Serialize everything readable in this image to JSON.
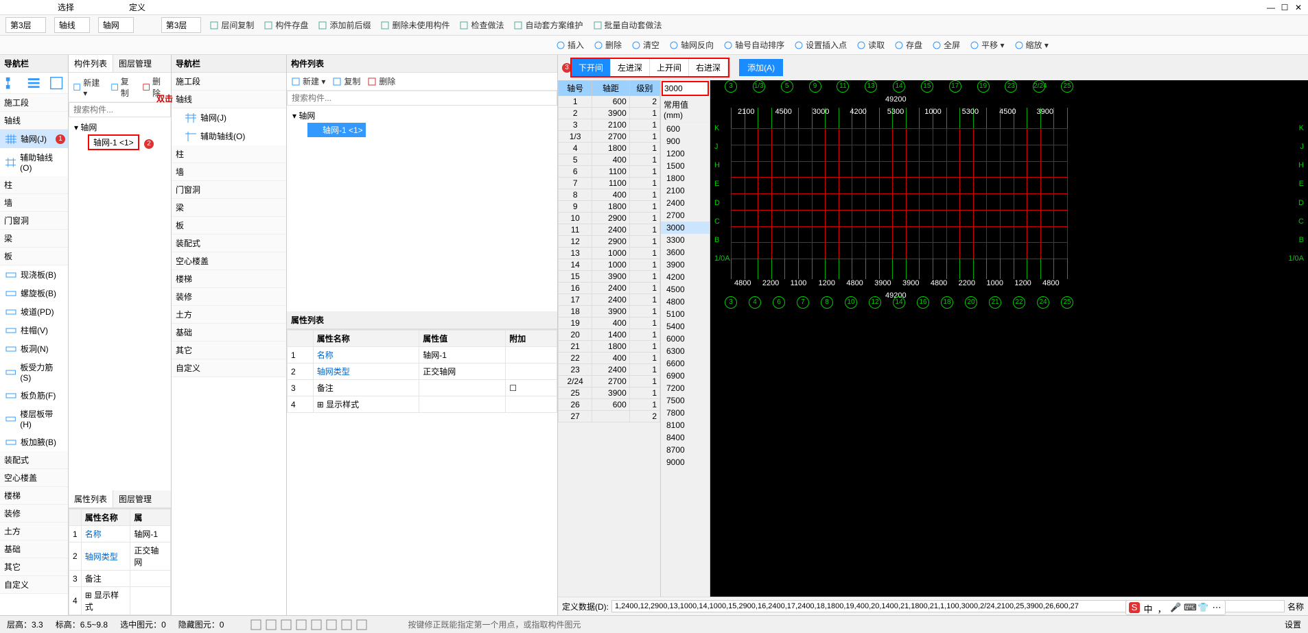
{
  "title_left": "选择",
  "title_center": "定义",
  "window_controls": {
    "min": "—",
    "max": "☐",
    "close": "✕"
  },
  "top_selects": {
    "floor_a": "第3层",
    "axis_a": "轴线",
    "obj_a": "轴网"
  },
  "ribbon2": {
    "floor": "第3层",
    "items": [
      "层间复制",
      "构件存盘",
      "添加前后缀",
      "删除未使用构件",
      "检查做法",
      "自动套方案维护",
      "批量自动套做法"
    ]
  },
  "toolbar2": {
    "items": [
      "插入",
      "删除",
      "清空",
      "轴网反向",
      "轴号自动排序",
      "设置插入点",
      "读取",
      "存盘",
      "全屏",
      "平移",
      "缩放"
    ]
  },
  "colA": {
    "nav": "导航栏",
    "section": "施工段",
    "axis": "轴线",
    "entries": [
      "轴网(J)",
      "辅助轴线(O)"
    ],
    "cats": [
      "柱",
      "墙",
      "门窗洞",
      "梁",
      "板"
    ],
    "board_items": [
      "现浇板(B)",
      "螺旋板(B)",
      "坡道(PD)",
      "柱帽(V)",
      "板洞(N)",
      "板受力筋(S)",
      "板负筋(F)",
      "楼层板带(H)",
      "板加腋(B)"
    ],
    "more": [
      "装配式",
      "空心楼盖",
      "楼梯",
      "装修",
      "土方",
      "基础",
      "其它",
      "自定义"
    ]
  },
  "colB": {
    "tabs": [
      "构件列表",
      "图层管理"
    ],
    "toolbar": [
      "新建",
      "复制",
      "删除"
    ],
    "search": "搜索构件...",
    "root": "轴网",
    "item": "轴网-1 <1>",
    "prop_tabs": [
      "属性列表",
      "图层管理"
    ],
    "prop_head": [
      "属性名称",
      "属"
    ],
    "props": [
      [
        "1",
        "名称",
        "轴网-1"
      ],
      [
        "2",
        "轴网类型",
        "正交轴网"
      ],
      [
        "3",
        "备注",
        ""
      ],
      [
        "4",
        "显示样式",
        ""
      ]
    ]
  },
  "colC": {
    "nav": "导航栏",
    "section": "施工段",
    "axis": "轴线",
    "entries": [
      "轴网(J)",
      "辅助轴线(O)"
    ],
    "cats": [
      "柱",
      "墙",
      "门窗洞",
      "梁",
      "板",
      "装配式",
      "空心楼盖",
      "楼梯",
      "装修",
      "土方",
      "基础",
      "其它",
      "自定义"
    ]
  },
  "colD": {
    "title": "构件列表",
    "toolbar": [
      "新建",
      "复制",
      "删除"
    ],
    "search": "搜索构件...",
    "root": "轴网",
    "item": "轴网-1 <1>",
    "prop_title": "属性列表",
    "prop_head": [
      "属性名称",
      "属性值",
      "附加"
    ],
    "props": [
      [
        "1",
        "名称",
        "轴网-1",
        ""
      ],
      [
        "2",
        "轴网类型",
        "正交轴网",
        ""
      ],
      [
        "3",
        "备注",
        "",
        "☐"
      ],
      [
        "4",
        "显示样式",
        "",
        ""
      ]
    ]
  },
  "grid_tabs": [
    "下开间",
    "左进深",
    "上开间",
    "右进深"
  ],
  "add_btn": "添加(A)",
  "table_head": [
    "轴号",
    "轴距",
    "级别"
  ],
  "table_rows": [
    [
      "1",
      "600",
      "2"
    ],
    [
      "2",
      "3900",
      "1"
    ],
    [
      "3",
      "2100",
      "1"
    ],
    [
      "1/3",
      "2700",
      "1"
    ],
    [
      "4",
      "1800",
      "1"
    ],
    [
      "5",
      "400",
      "1"
    ],
    [
      "6",
      "1100",
      "1"
    ],
    [
      "7",
      "1100",
      "1"
    ],
    [
      "8",
      "400",
      "1"
    ],
    [
      "9",
      "1800",
      "1"
    ],
    [
      "10",
      "2900",
      "1"
    ],
    [
      "11",
      "2400",
      "1"
    ],
    [
      "12",
      "2900",
      "1"
    ],
    [
      "13",
      "1000",
      "1"
    ],
    [
      "14",
      "1000",
      "1"
    ],
    [
      "15",
      "3900",
      "1"
    ],
    [
      "16",
      "2400",
      "1"
    ],
    [
      "17",
      "2400",
      "1"
    ],
    [
      "18",
      "3900",
      "1"
    ],
    [
      "19",
      "400",
      "1"
    ],
    [
      "20",
      "1400",
      "1"
    ],
    [
      "21",
      "1800",
      "1"
    ],
    [
      "22",
      "400",
      "1"
    ],
    [
      "23",
      "2400",
      "1"
    ],
    [
      "2/24",
      "2700",
      "1"
    ],
    [
      "25",
      "3900",
      "1"
    ],
    [
      "26",
      "600",
      "1"
    ],
    [
      "27",
      "",
      "2"
    ]
  ],
  "preset_label": "常用值(mm)",
  "preset_input": "3000",
  "presets": [
    "600",
    "900",
    "1200",
    "1500",
    "1800",
    "2100",
    "2400",
    "2700",
    "3000",
    "3300",
    "3600",
    "3900",
    "4200",
    "4500",
    "4800",
    "5100",
    "5400",
    "6000",
    "6300",
    "6600",
    "6900",
    "7200",
    "7500",
    "7800",
    "8100",
    "8400",
    "8700",
    "9000"
  ],
  "def_label": "定义数据(D):",
  "def_value": "1,2400,12,2900,13,1000,14,1000,15,2900,16,2400,17,2400,18,1800,19,400,20,1400,21,1800,21,1,100,3000,2/24,2100,25,3900,26,600,27",
  "canvas": {
    "total": "49200",
    "top_circles": [
      "3",
      "1/3",
      "5",
      "9",
      "11",
      "13",
      "14",
      "15",
      "17",
      "19",
      "23",
      "2/24",
      "25"
    ],
    "bot_circles": [
      "3",
      "4",
      "6",
      "7",
      "8",
      "10",
      "12",
      "14",
      "16",
      "18",
      "20",
      "21",
      "22",
      "24",
      "25"
    ],
    "left_labels": [
      "K",
      "J",
      "H",
      "E",
      "D",
      "C",
      "B",
      "1/0A"
    ],
    "right_labels": [
      "K",
      "J",
      "H",
      "E",
      "D",
      "C",
      "B",
      "1/0A"
    ],
    "top_dims": [
      "2100",
      "4500",
      "3000",
      "4200",
      "5300",
      "1000",
      "5300",
      "4500",
      "3900"
    ],
    "bot_dims": [
      "4800",
      "2200",
      "1100",
      "1200",
      "4800",
      "3900",
      "3900",
      "4800",
      "2200",
      "1000",
      "1200",
      "4800"
    ]
  },
  "status": {
    "height": "层高：3.3",
    "elev": "标高：6.5~9.8",
    "sel": "选中图元：0",
    "hidden": "隐藏图元：0",
    "hint": "按键修正既能指定第一个用点，或指取构件图元",
    "right": "设置"
  },
  "ime": [
    "中",
    "，",
    "🎤",
    "⌨",
    "👕",
    "⋯"
  ]
}
